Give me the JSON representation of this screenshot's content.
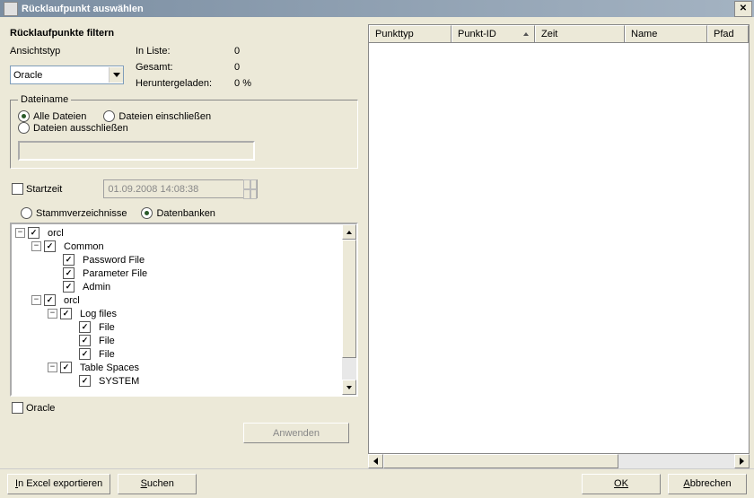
{
  "window": {
    "title": "Rücklaufpunkt auswählen"
  },
  "filter": {
    "title": "Rücklaufpunkte filtern",
    "view_type_label": "Ansichtstyp",
    "view_type_value": "Oracle",
    "stats": {
      "in_list_label": "In Liste:",
      "in_list_value": "0",
      "total_label": "Gesamt:",
      "total_value": "0",
      "downloaded_label": "Heruntergeladen:",
      "downloaded_value": "0 %"
    },
    "filename_group": {
      "legend": "Dateiname",
      "all": "Alle Dateien",
      "include": "Dateien einschließen",
      "exclude": "Dateien ausschließen"
    },
    "start_time_label": "Startzeit",
    "start_time_value": "01.09.2008 14:08:38",
    "source_radios": {
      "root_dirs": "Stammverzeichnisse",
      "databases": "Datenbanken"
    },
    "oracle_label": "Oracle",
    "apply_label": "Anwenden"
  },
  "tree": {
    "orcl": "orcl",
    "common": "Common",
    "password_file": "Password File",
    "parameter_file": "Parameter File",
    "admin": "Admin",
    "orcl2": "orcl",
    "log_files": "Log files",
    "file": "File",
    "table_spaces": "Table Spaces",
    "system": "SYSTEM"
  },
  "table": {
    "headers": {
      "type": "Punkttyp",
      "id": "Punkt-ID",
      "time": "Zeit",
      "name": "Name",
      "path": "Pfad"
    }
  },
  "footer": {
    "export": "In Excel exportieren",
    "search": "Suchen",
    "ok": "OK",
    "cancel": "Abbrechen"
  }
}
